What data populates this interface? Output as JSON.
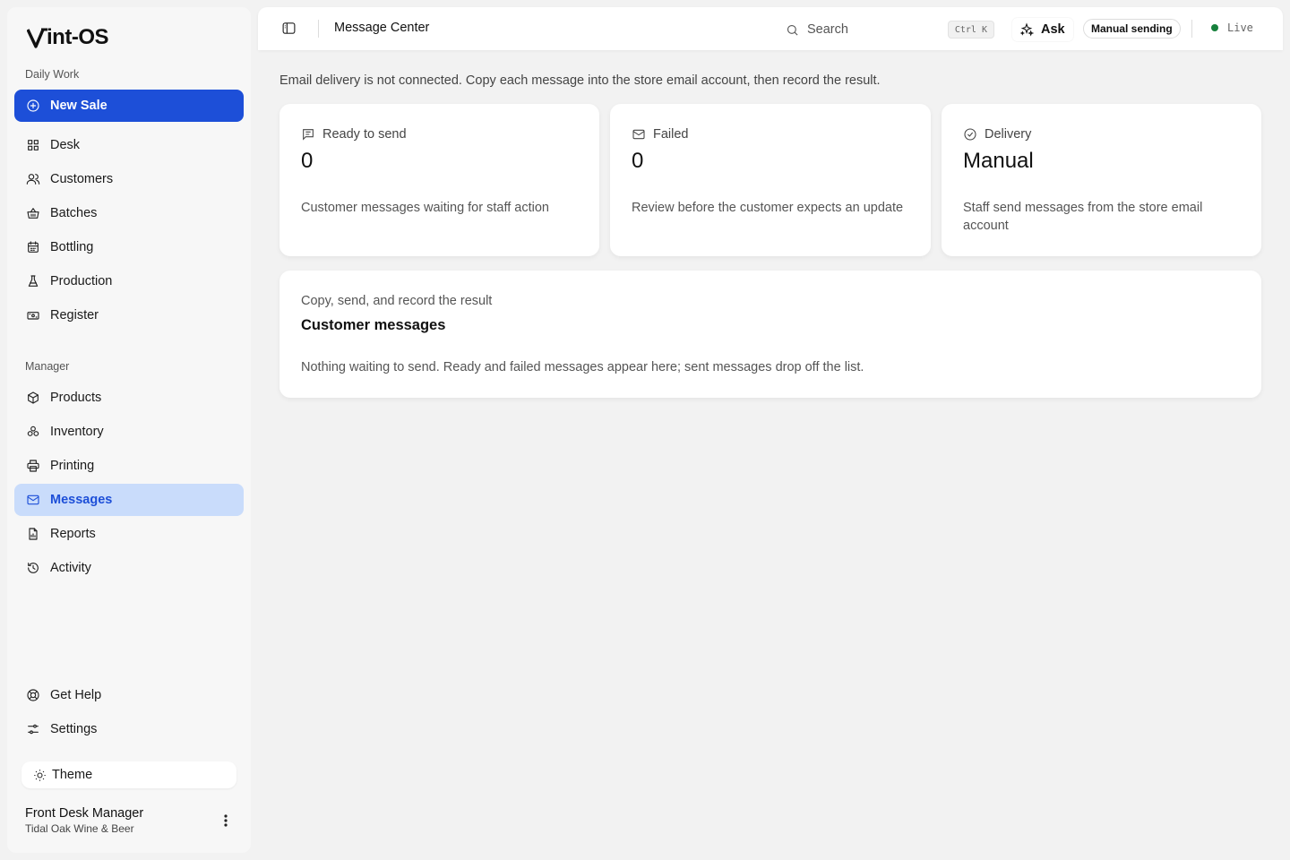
{
  "app": {
    "logo_text": "int-OS"
  },
  "sidebar": {
    "daily_label": "Daily Work",
    "new_sale": "New Sale",
    "daily_items": [
      {
        "label": "Desk",
        "icon": "grid-icon"
      },
      {
        "label": "Customers",
        "icon": "users-icon"
      },
      {
        "label": "Batches",
        "icon": "basket-icon"
      },
      {
        "label": "Bottling",
        "icon": "calendar-icon"
      },
      {
        "label": "Production",
        "icon": "flask-icon"
      },
      {
        "label": "Register",
        "icon": "cash-icon"
      }
    ],
    "manager_label": "Manager",
    "manager_items": [
      {
        "label": "Products",
        "icon": "box-icon"
      },
      {
        "label": "Inventory",
        "icon": "stack-icon"
      },
      {
        "label": "Printing",
        "icon": "printer-icon"
      },
      {
        "label": "Messages",
        "icon": "mail-icon",
        "active": true
      },
      {
        "label": "Reports",
        "icon": "report-icon"
      },
      {
        "label": "Activity",
        "icon": "history-icon"
      }
    ],
    "footer_items": [
      {
        "label": "Get Help",
        "icon": "lifebuoy-icon"
      },
      {
        "label": "Settings",
        "icon": "sliders-icon"
      }
    ],
    "theme_label": "Theme",
    "user": {
      "name": "Front Desk Manager",
      "org": "Tidal Oak Wine & Beer"
    }
  },
  "topbar": {
    "title": "Message Center",
    "search_placeholder": "Search",
    "shortcut": "Ctrl K",
    "ask_label": "Ask",
    "mode_badge": "Manual sending",
    "status": "Live"
  },
  "main": {
    "notice": "Email delivery is not connected. Copy each message into the store email account, then record the result.",
    "cards": [
      {
        "label": "Ready to send",
        "icon": "message-icon",
        "value": "0",
        "description": "Customer messages waiting for staff action"
      },
      {
        "label": "Failed",
        "icon": "mail-icon",
        "value": "0",
        "description": "Review before the customer expects an update"
      },
      {
        "label": "Delivery",
        "icon": "check-circle-icon",
        "value": "Manual",
        "description": "Staff send messages from the store email account"
      }
    ],
    "panel": {
      "subtitle": "Copy, send, and record the result",
      "title": "Customer messages",
      "empty": "Nothing waiting to send. Ready and failed messages appear here; sent messages drop off the list."
    }
  },
  "colors": {
    "accent": "#1d4fd8",
    "active_bg": "#c9dcfb",
    "live": "#16803c"
  }
}
